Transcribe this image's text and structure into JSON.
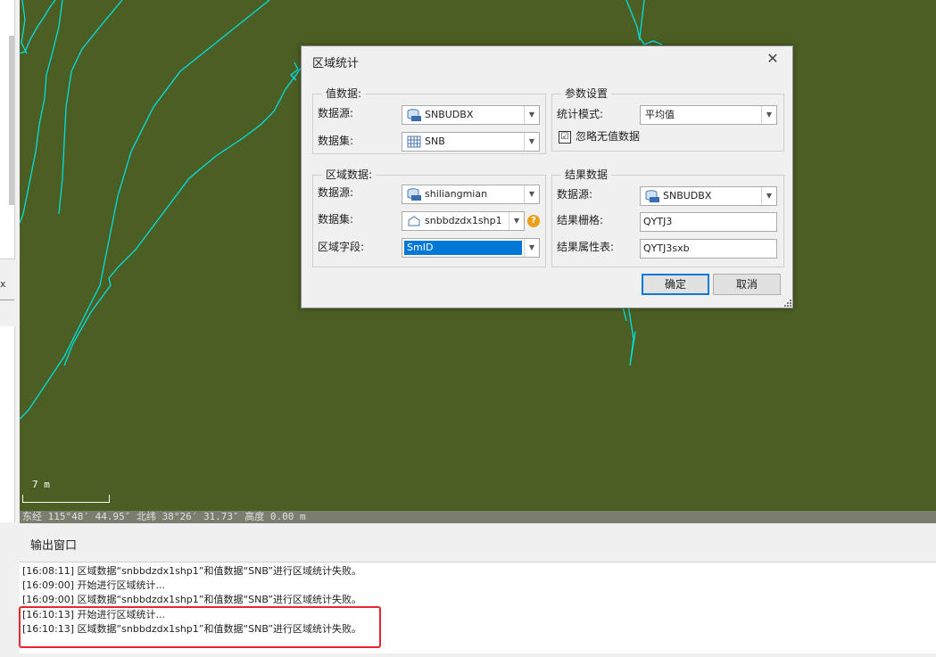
{
  "dialog": {
    "title": "区域统计",
    "value_group": {
      "title": "值数据:",
      "datasource_label": "数据源:",
      "datasource_value": "SNBUDBX",
      "dataset_label": "数据集:",
      "dataset_value": "SNB"
    },
    "region_group": {
      "title": "区域数据:",
      "datasource_label": "数据源:",
      "datasource_value": "shiliangmian",
      "dataset_label": "数据集:",
      "dataset_value": "snbbdzdx1shp1",
      "field_label": "区域字段:",
      "field_value": "SmID"
    },
    "params_group": {
      "title": "参数设置",
      "mode_label": "统计模式:",
      "mode_value": "平均值",
      "ignore_nodata_label": "忽略无值数据",
      "ignore_nodata_checked": "☑"
    },
    "result_group": {
      "title": "结果数据",
      "datasource_label": "数据源:",
      "datasource_value": "SNBUDBX",
      "grid_label": "结果栅格:",
      "grid_value": "QYTJ3",
      "table_label": "结果属性表:",
      "table_value": "QYTJ3sxb"
    },
    "ok_label": "确定",
    "cancel_label": "取消",
    "close_glyph": "✕"
  },
  "map": {
    "scale_text": "7 m",
    "status_text": "东经 115°48′ 44.95″  北纬 38°26′ 31.73″  高度 0.00 m",
    "background": "#4b5e23",
    "line_color": "#00e0e0"
  },
  "left_panel": {
    "close_glyph": "x"
  },
  "output": {
    "title": "输出窗口",
    "lines": [
      "[16:08:11] 区域数据“snbbdzdx1shp1”和值数据“SNB”进行区域统计失败。",
      "[16:09:00] 开始进行区域统计...",
      "[16:09:00] 区域数据“snbbdzdx1shp1”和值数据“SNB”进行区域统计失败。",
      "[16:10:13] 开始进行区域统计...",
      "[16:10:13] 区域数据“snbbdzdx1shp1”和值数据“SNB”进行区域统计失败。"
    ]
  },
  "icons": {
    "datasource": "database-udbx-icon",
    "grid_dataset": "grid-dataset-icon",
    "region_dataset": "region-dataset-icon",
    "help": "help-icon"
  },
  "colors": {
    "highlight": "#e8262e",
    "selection": "#0078d7"
  }
}
